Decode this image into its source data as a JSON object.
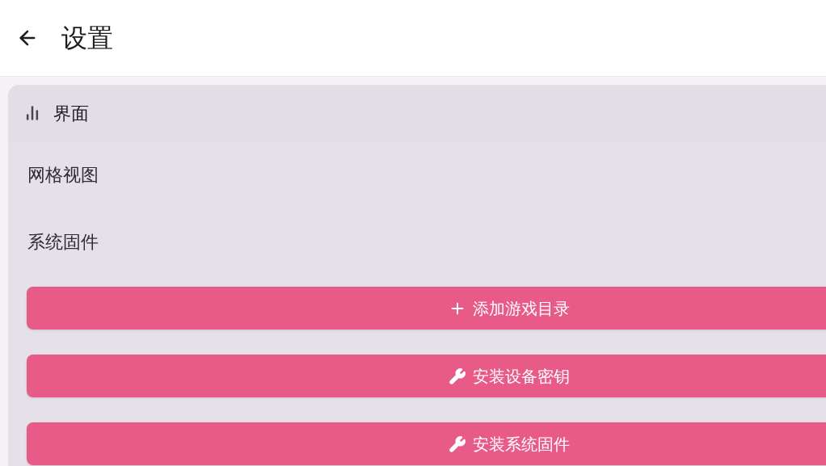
{
  "header": {
    "title": "设置"
  },
  "section": {
    "title": "界面",
    "items": [
      {
        "label": "网格视图"
      },
      {
        "label": "系统固件"
      }
    ],
    "buttons": [
      {
        "label": "添加游戏目录",
        "kind": "add"
      },
      {
        "label": "安装设备密钥",
        "kind": "tool"
      },
      {
        "label": "安装系统固件",
        "kind": "tool"
      }
    ]
  }
}
